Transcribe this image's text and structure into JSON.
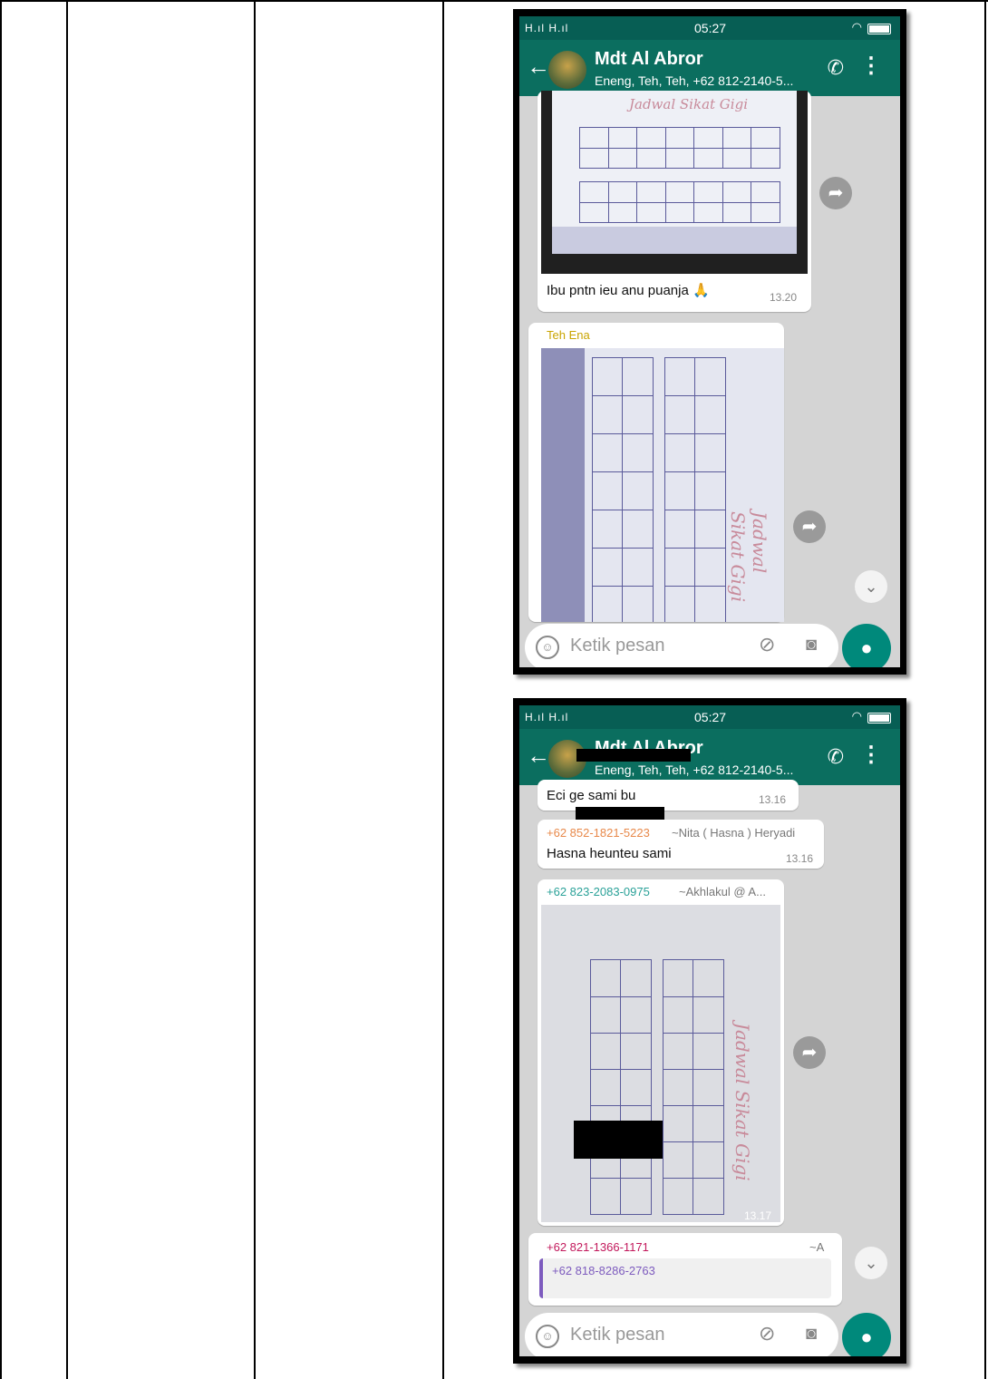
{
  "phone1": {
    "status": {
      "signal": "H.ıl H.ıl",
      "time": "05:27"
    },
    "header": {
      "title": "Mdt Al Abror",
      "subtitle": "Eneng, Teh, Teh, +62 812-2140-5..."
    },
    "messages": [
      {
        "image_label": "Jadwal Sikat Gigi",
        "text": "Ibu pntn ieu anu puanja 🙏",
        "time": "13.20"
      },
      {
        "sender": "Teh Ena",
        "image_label": "Jadwal Sikat Gigi"
      }
    ],
    "input": {
      "placeholder": "Ketik pesan"
    }
  },
  "phone2": {
    "status": {
      "signal": "H.ıl H.ıl",
      "time": "05:27"
    },
    "header": {
      "title": "Mdt Al Abror",
      "subtitle": "Eneng, Teh, Teh, +62 812-2140-5..."
    },
    "messages": [
      {
        "text": "Eci ge sami bu",
        "time": "13.16"
      },
      {
        "sender_number": "+62 852-1821-5223",
        "sender_name": "~Nita ( Hasna ) Heryadi",
        "text": "Hasna heunteu sami",
        "time": "13.16"
      },
      {
        "sender_number": "+62 823-2083-0975",
        "sender_name": "~Akhlakul @ A...",
        "image_label": "Jadwal Sikat Gigi",
        "time": "13.17"
      },
      {
        "sender_number": "+62 821-1366-1171",
        "sender_name": "~A",
        "quote_number": "+62 818-8286-2763"
      }
    ],
    "input": {
      "placeholder": "Ketik pesan"
    }
  },
  "colors": {
    "header": "#0b6e5f",
    "mic": "#00897b",
    "sender_teh_ena": "#c9a400",
    "sender_orange": "#e8894a",
    "sender_teal": "#2aa198",
    "sender_pink": "#c2185b",
    "quote_text": "#7d5bbe"
  },
  "icons": [
    "back-arrow-icon",
    "add-call-icon",
    "more-vert-icon",
    "forward-icon",
    "scroll-down-icon",
    "emoji-icon",
    "attach-icon",
    "camera-icon",
    "mic-icon",
    "wifi-icon",
    "battery-icon"
  ]
}
